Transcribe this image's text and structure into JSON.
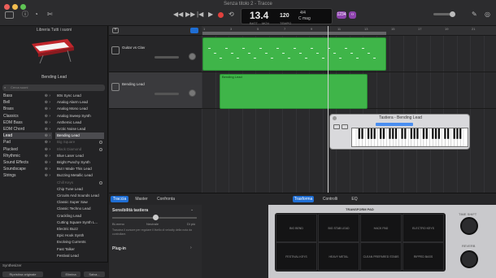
{
  "window": {
    "title": "Senza titolo 2 - Tracce"
  },
  "lcd": {
    "bar_beat": "13.4",
    "bar_label": "BATT",
    "beat_label": "MOV",
    "tempo": "120",
    "tempo_label": "TEMPO",
    "signature": "4/4",
    "key": "C mag"
  },
  "toolbar": {
    "count_in": "1234",
    "badge_purple": "‹›",
    "colors": {
      "record": "#e0413d",
      "accent": "#1f6ed4",
      "region": "#3fb549",
      "purple": "#8e44ad"
    }
  },
  "library": {
    "header": "Libreria   Tutti i suoni",
    "instrument": "Bending Lead",
    "search_placeholder": "Cerca suoni",
    "categories": [
      "Bass",
      "Bell",
      "Brass",
      "Classics",
      "EDM Bass",
      "EDM Chord",
      "Lead",
      "Pad",
      "Plucked",
      "Rhythmic",
      "Sound Effects",
      "Soundscape",
      "Strings"
    ],
    "patches": [
      "80s Sync Lead",
      "Analog Alarm Lead",
      "Analog Mono Lead",
      "Analog Sweep Synth",
      "Anthemic Lead",
      "Arctic Noise Lead",
      "Bending Lead",
      "Big Square",
      "Black Diamond",
      "Blue Laser Lead",
      "Bright Punchy Synth",
      "But I Made This Lead",
      "Buzzing Metallic Lead",
      "Chill Keys",
      "Chip Tune Lead",
      "Circuits And Sounds Lead",
      "Classic Super Saw",
      "Classic Techno Lead",
      "Crackling Lead",
      "Cutting Square Synth L...",
      "Electric Buzz",
      "Epic Hook Synth",
      "Evolving Currents",
      "Fast Talker",
      "Festival Lead"
    ],
    "footer_label": "Synthesizer",
    "revert_button": "Ripristina originale",
    "delete_button": "Elimina",
    "save_button": "Salva..."
  },
  "tracks": [
    {
      "name": "Guitar vs Clav"
    },
    {
      "name": "Bending Lead"
    }
  ],
  "ruler": {
    "ticks": [
      "1",
      "3",
      "5",
      "7",
      "9",
      "11",
      "13",
      "15",
      "17",
      "19",
      "21"
    ]
  },
  "regions": [
    {
      "label": ""
    },
    {
      "label": "Bending Lead"
    }
  ],
  "keyboard_window": {
    "title": "Tastiera - Bending Lead"
  },
  "editor": {
    "tabs_left": [
      "Traccia",
      "Master",
      "Confronta"
    ],
    "tabs_right": [
      "Trasforma",
      "Controlli",
      "EQ"
    ],
    "velocity_title": "Sensibilità tastiera",
    "velocity_min": "Bi-meno",
    "velocity_mid": "Neutrale",
    "velocity_max": "Di più",
    "velocity_desc": "Trascina il cursore per regolare il livello di velocity della nota da controllare.",
    "plugin_label": "Plug-in",
    "pad_title": "TRANSFORM PAD",
    "pad_cells": [
      "BIG BEND",
      "BIG STAB LEAD",
      "HACK PAD",
      "ELECTRO KEYS",
      "FESTIVAL KEYS",
      "HEAVY METAL",
      "CLEAN PREPARED STABS",
      "RIPPED BASS"
    ],
    "knob1": "TIME SHIFT",
    "knob2": "REVERB"
  }
}
